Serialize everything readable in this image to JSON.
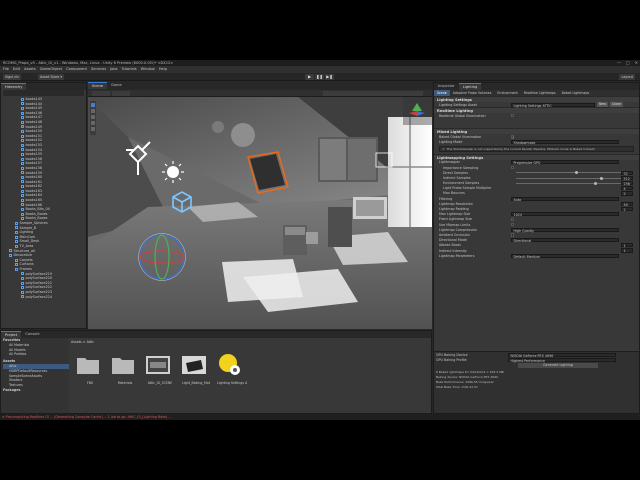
{
  "window": {
    "title": "RCOMG_Propa_v5 - Attic_GI_v1 - Windows, Mac, Linux - Unity 6 Preview (6000.0.0f1)* <DX12>",
    "controls": [
      "—",
      "□",
      "✕"
    ]
  },
  "menubar": [
    "File",
    "Edit",
    "Assets",
    "GameObject",
    "Component",
    "Services",
    "Jobs",
    "Tutorials",
    "Window",
    "Help"
  ],
  "toolbar": {
    "account": "Signi.dn",
    "asset_store": "Asset Store ▾",
    "layout": "Layout"
  },
  "hierarchy": {
    "tab": "Hierarchy",
    "items": [
      {
        "label": "books143",
        "indent": 3
      },
      {
        "label": "books144",
        "indent": 3
      },
      {
        "label": "books145",
        "indent": 3
      },
      {
        "label": "books146",
        "indent": 3
      },
      {
        "label": "books147",
        "indent": 3
      },
      {
        "label": "books148",
        "indent": 3
      },
      {
        "label": "books149",
        "indent": 3
      },
      {
        "label": "books150",
        "indent": 3
      },
      {
        "label": "books151",
        "indent": 3
      },
      {
        "label": "books152",
        "indent": 3
      },
      {
        "label": "books153",
        "indent": 3
      },
      {
        "label": "books154",
        "indent": 3
      },
      {
        "label": "books155",
        "indent": 3
      },
      {
        "label": "books156",
        "indent": 3
      },
      {
        "label": "books157",
        "indent": 3
      },
      {
        "label": "books158",
        "indent": 3
      },
      {
        "label": "books159",
        "indent": 3
      },
      {
        "label": "books160",
        "indent": 3
      },
      {
        "label": "books161",
        "indent": 3
      },
      {
        "label": "books162",
        "indent": 3
      },
      {
        "label": "books163",
        "indent": 3
      },
      {
        "label": "books164",
        "indent": 3
      },
      {
        "label": "books165",
        "indent": 3
      },
      {
        "label": "books166",
        "indent": 3
      },
      {
        "label": "Books_Bits_04",
        "indent": 3
      },
      {
        "label": "Books_Boxes",
        "indent": 3
      },
      {
        "label": "Books_Boxes",
        "indent": 3
      },
      {
        "label": "Sample_Spheres",
        "indent": 2
      },
      {
        "label": "Sample_B",
        "indent": 2
      },
      {
        "label": "Lighting",
        "indent": 2
      },
      {
        "label": "MainCam",
        "indent": 2
      },
      {
        "label": "Small_Desk",
        "indent": 2
      },
      {
        "label": "TV_Area",
        "indent": 2
      },
      {
        "label": "Structure_all",
        "indent": 1
      },
      {
        "label": "Decorative",
        "indent": 1
      },
      {
        "label": "Carpets",
        "indent": 2
      },
      {
        "label": "Curtains",
        "indent": 2
      },
      {
        "label": "Frames",
        "indent": 2
      },
      {
        "label": "polySurface219",
        "indent": 3
      },
      {
        "label": "polySurface220",
        "indent": 3
      },
      {
        "label": "polySurface221",
        "indent": 3
      },
      {
        "label": "polySurface222",
        "indent": 3
      },
      {
        "label": "polySurface223",
        "indent": 3
      },
      {
        "label": "polySurface224",
        "indent": 3
      }
    ]
  },
  "scene_tabs": [
    "Scene",
    "Game"
  ],
  "inspector": {
    "panel_tabs": [
      "Inspector",
      "Lighting"
    ],
    "sub_tabs": [
      "Scene",
      "Adaptive Probe Volumes",
      "Environment",
      "Realtime Lightmaps",
      "Baked Lightmaps"
    ],
    "lighting_settings_title": "Lighting Settings",
    "lighting_settings_asset_label": "Lighting Settings Asset",
    "lighting_settings_asset_value": "Lighting Settings ATTIC",
    "new_btn": "New",
    "clone_btn": "Clone",
    "realtime_title": "Realtime Lighting",
    "realtime_gi_label": "Realtime Global Illumination",
    "mixed_title": "Mixed Lighting",
    "baked_gi_label": "Baked Global Illumination",
    "lighting_mode_label": "Lighting Mode",
    "lighting_mode_value": "Shadowmask",
    "warning_text": "The Shadowmask is not supported by the current Render Pipeline. Fallback mode is Baked Indirect.",
    "lightmapping_title": "Lightmapping Settings",
    "rows": [
      {
        "label": "Lightmapper",
        "value": "Progressive GPU",
        "kind": "dropdown"
      },
      {
        "label": "Importance Sampling",
        "value": "",
        "kind": "check"
      },
      {
        "label": "Direct Samples",
        "value": "32",
        "kind": "slider",
        "fill": 0.55
      },
      {
        "label": "Indirect Samples",
        "value": "512",
        "kind": "slider",
        "fill": 0.78
      },
      {
        "label": "Environment Samples",
        "value": "256",
        "kind": "slider",
        "fill": 0.72
      },
      {
        "label": "Light Probe Sample Multiplier",
        "value": "4",
        "kind": "num"
      },
      {
        "label": "Max Bounces",
        "value": "2",
        "kind": "num"
      },
      {
        "label": "Filtering",
        "value": "Auto",
        "kind": "dropdown"
      },
      {
        "label": "Lightmap Resolution",
        "value": "40",
        "kind": "num"
      },
      {
        "label": "Lightmap Padding",
        "value": "2",
        "kind": "num"
      },
      {
        "label": "Max Lightmap Size",
        "value": "1024",
        "kind": "dropdown"
      },
      {
        "label": "Fixed Lightmap Size",
        "value": "",
        "kind": "check"
      },
      {
        "label": "Use Mipmap Limits",
        "value": "",
        "kind": "check"
      },
      {
        "label": "Lightmap Compression",
        "value": "High Quality",
        "kind": "dropdown"
      },
      {
        "label": "Ambient Occlusion",
        "value": "",
        "kind": "check"
      },
      {
        "label": "Directional Mode",
        "value": "Directional",
        "kind": "dropdown"
      },
      {
        "label": "Albedo Boost",
        "value": "1",
        "kind": "num"
      },
      {
        "label": "Indirect Intensity",
        "value": "1",
        "kind": "num"
      },
      {
        "label": "Lightmap Parameters",
        "value": "Default-Medium",
        "kind": "dropdown"
      }
    ],
    "bottom_tabs_label": "GPU Baking Device",
    "gpu_device": "NVIDIA GeForce RTX 4090",
    "gpu_profile_label": "GPU Baking Profile",
    "gpu_profile": "Highest Performance",
    "generate_btn": "Generate Lighting",
    "stats": [
      "0 Baked lightmaps for 0/0x4/0x4 = 163.2 MB",
      "Baking device: NVIDIA GeForce RTX 4090",
      "Bake Performance: 4286.55 mrays/sec",
      "Total Bake Time: 0:00:22.51"
    ]
  },
  "project": {
    "tabs": [
      "Project",
      "Console"
    ],
    "favorites_title": "Favorites",
    "favorites": [
      "All Materials",
      "All Models",
      "All Prefabs"
    ],
    "assets_title": "Assets",
    "folders": [
      "Attic",
      "HDRPDefaultResources",
      "SampleSceneAssets",
      "Shaders",
      "Textures"
    ],
    "packages_title": "Packages",
    "breadcrumb": "Assets > Attic",
    "assets": [
      {
        "label": "FBX",
        "kind": "folder"
      },
      {
        "label": "Materials",
        "kind": "folder"
      },
      {
        "label": "Attic_GI_SCENE",
        "kind": "scene"
      },
      {
        "label": "Light_Baking_Mat",
        "kind": "mesh"
      },
      {
        "label": "Lighting Settings ATTIC",
        "kind": "settings"
      }
    ]
  },
  "statusbar": {
    "text": "Precomputing Realtime GI ... [Generating Compute Cache] ... 1 job to go. AttiC_GI_[Lighting Bake] ..."
  },
  "colors": {
    "accent": "#3a7bd5",
    "tree_cube": "#5aa0e8",
    "error_text": "#e05555",
    "highlight_frame": "#e86a1a"
  }
}
